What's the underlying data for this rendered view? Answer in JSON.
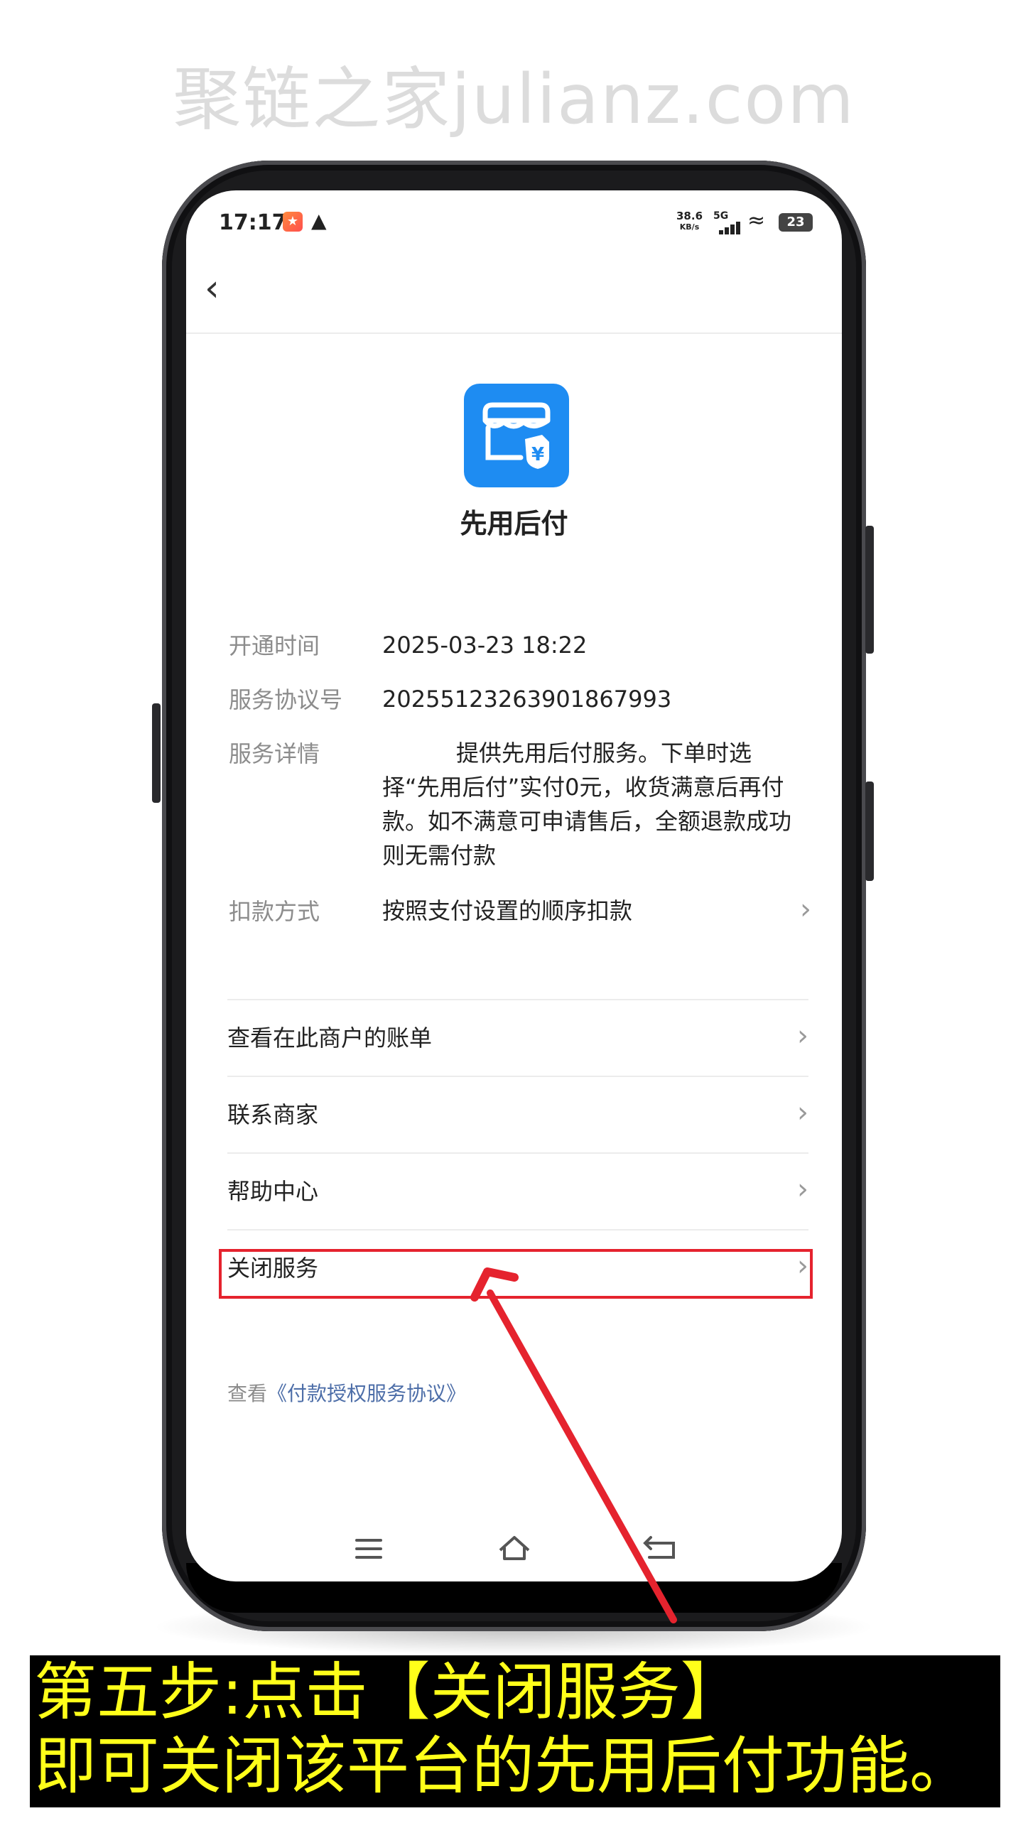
{
  "watermark": "聚链之家julianz.com",
  "status_bar": {
    "time": "17:17",
    "net_speed_value": "38.6",
    "net_speed_unit": "KB/s",
    "network": "5G",
    "battery": "23"
  },
  "service": {
    "title": "先用后付",
    "logo_color": "#1e8cf2"
  },
  "details": [
    {
      "label": "开通时间",
      "value": "2025-03-23 18:22"
    },
    {
      "label": "服务协议号",
      "value": "20255123263901867993"
    },
    {
      "label": "服务详情",
      "value": "提供先用后付服务。下单时选择“先用后付”实付0元，收货满意后再付款。如不满意可申请售后，全额退款成功则无需付款"
    },
    {
      "label": "扣款方式",
      "value": "按照支付设置的顺序扣款"
    }
  ],
  "menu": [
    {
      "label": "查看在此商户的账单"
    },
    {
      "label": "联系商家"
    },
    {
      "label": "帮助中心"
    },
    {
      "label": "关闭服务"
    }
  ],
  "agreement": {
    "prefix": "查看",
    "link": "《付款授权服务协议》"
  },
  "caption": {
    "line1": "第五步:点击【关闭服务】",
    "line2": "即可关闭该平台的先用后付功能。"
  },
  "colors": {
    "highlight": "#e5232e",
    "caption_text": "#ffff1a",
    "caption_bg": "#000000"
  }
}
